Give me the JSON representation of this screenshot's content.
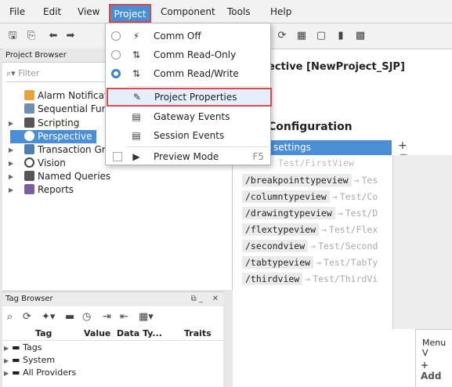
{
  "menubar": {
    "items": [
      "File",
      "Edit",
      "View",
      "Project",
      "Component",
      "Tools",
      "Help"
    ]
  },
  "project_menu": {
    "comm_off": "Comm Off",
    "comm_read_only": "Comm Read-Only",
    "comm_read_write": "Comm Read/Write",
    "project_properties": "Project Properties",
    "gateway_events": "Gateway Events",
    "session_events": "Session Events",
    "preview_mode": "Preview Mode",
    "preview_shortcut": "F5"
  },
  "project_browser": {
    "title": "Project Browser",
    "filter_placeholder": "Filter",
    "items": [
      "Alarm Notificati",
      "Sequential Func",
      "Scripting",
      "Perspective",
      "Transaction Gro",
      "Vision",
      "Named Queries",
      "Reports"
    ]
  },
  "workspace": {
    "title": "ective [NewProject_SJP]",
    "section_title": "Configuration",
    "settings_label": "settings",
    "first_route_view": "Test/FirstView",
    "routes": [
      {
        "path": "/breakpointtypeview",
        "view": "Tes"
      },
      {
        "path": "/columntypeview",
        "view": "Test/Co"
      },
      {
        "path": "/drawingtypeview",
        "view": "Test/D"
      },
      {
        "path": "/flextypeview",
        "view": "Test/Flex"
      },
      {
        "path": "/secondview",
        "view": "Test/Second"
      },
      {
        "path": "/tabtypeview",
        "view": "Test/TabTy"
      },
      {
        "path": "/thirdview",
        "view": "Test/ThirdVi"
      }
    ],
    "menu_label": "Menu V",
    "add_label": "Add"
  },
  "tag_browser": {
    "title": "Tag Browser",
    "columns": [
      "Tag",
      "Value",
      "Data Ty...",
      "Traits"
    ],
    "rows": [
      "Tags",
      "System",
      "All Providers"
    ]
  },
  "colors": {
    "selection": "#4a8fd6",
    "highlight_outline": "#d84a4a"
  }
}
